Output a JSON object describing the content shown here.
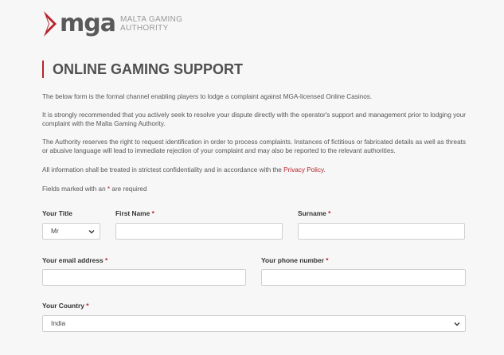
{
  "header": {
    "logo_text": "mga",
    "org_line1": "MALTA GAMING",
    "org_line2": "AUTHORITY",
    "colors": {
      "accent": "#b5252d",
      "logo_grey": "#5a5a5a"
    }
  },
  "page": {
    "title": "ONLINE GAMING SUPPORT",
    "intro": "The below form is the formal channel enabling players to lodge a complaint against MGA-licensed Online Casinos.",
    "recommendation": "It is strongly recommended that you actively seek to resolve your dispute directly with the operator's support and management prior to lodging your complaint with the Malta Gaming Authority.",
    "identification": "The Authority reserves the right to request identification in order to process complaints. Instances of fictitious or fabricated details as well as threats or abusive language will lead to immediate rejection of your complaint and may also be reported to the relevant authorities.",
    "confidentiality_prefix": "All information shall be treated in strictest confidentiality and in accordance with the ",
    "privacy_link": "Privacy Policy",
    "confidentiality_suffix": ".",
    "required_prefix": "Fields marked with an ",
    "required_star": "*",
    "required_suffix": " are required"
  },
  "form": {
    "title_label": "Your Title",
    "title_value": "Mr",
    "first_name_label": "First Name",
    "first_name_value": "",
    "surname_label": "Surname",
    "surname_value": "",
    "email_label": "Your email address",
    "email_value": "",
    "phone_label": "Your phone number",
    "phone_value": "",
    "country_label": "Your Country",
    "country_value": "India",
    "required_marker": "*"
  }
}
